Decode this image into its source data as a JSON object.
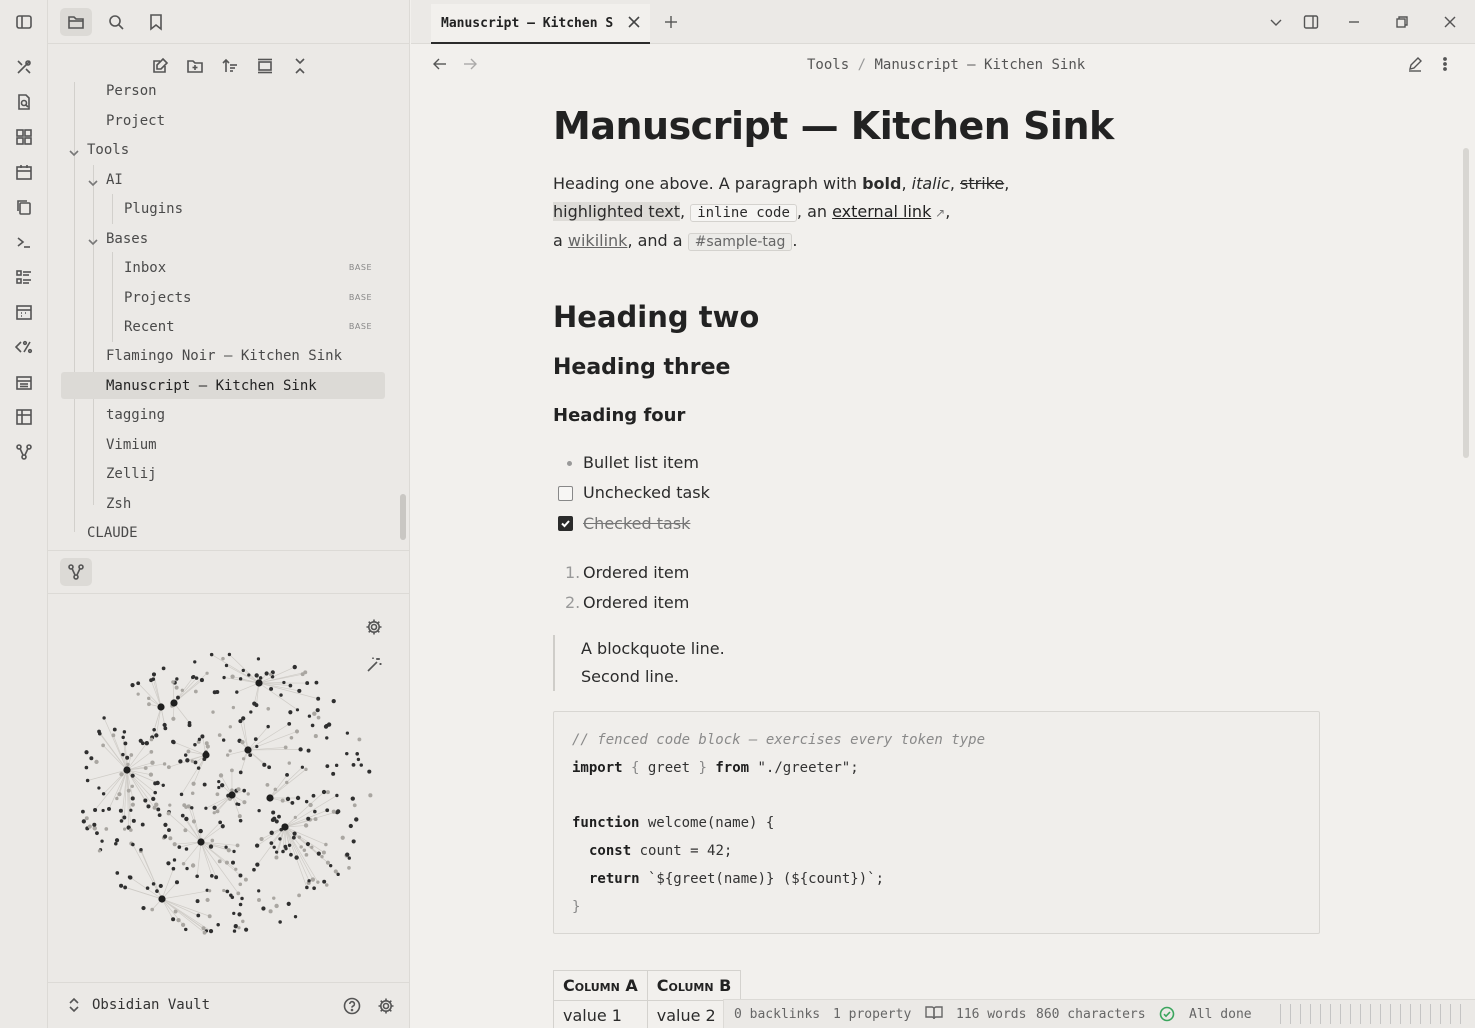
{
  "ribbon": {
    "icons": [
      "tools-icon",
      "search-doc-icon",
      "grid-icon",
      "calendar-icon",
      "copy-icon",
      "terminal-icon",
      "list-icon",
      "calendar-grid-icon",
      "regex-icon",
      "calendar-alt-icon",
      "table-icon",
      "graph-icon"
    ]
  },
  "nav": {
    "tree": [
      {
        "label": "Person",
        "badge": ""
      },
      {
        "label": "Project",
        "badge": ""
      },
      {
        "label": "Tools",
        "badge": ""
      },
      {
        "label": "AI",
        "badge": ""
      },
      {
        "label": "Plugins",
        "badge": ""
      },
      {
        "label": "Bases",
        "badge": ""
      },
      {
        "label": "Inbox",
        "badge": "BASE"
      },
      {
        "label": "Projects",
        "badge": "BASE"
      },
      {
        "label": "Recent",
        "badge": "BASE"
      },
      {
        "label": "Flamingo Noir — Kitchen Sink",
        "badge": ""
      },
      {
        "label": "Manuscript — Kitchen Sink",
        "badge": ""
      },
      {
        "label": "tagging",
        "badge": ""
      },
      {
        "label": "Vimium",
        "badge": ""
      },
      {
        "label": "Zellij",
        "badge": ""
      },
      {
        "label": "Zsh",
        "badge": ""
      },
      {
        "label": "CLAUDE",
        "badge": ""
      }
    ]
  },
  "vault": {
    "name": "Obsidian Vault"
  },
  "tab": {
    "title": "Manuscript — Kitchen Sink"
  },
  "breadcrumb": {
    "folder": "Tools",
    "sep": "/",
    "file": "Manuscript — Kitchen Sink"
  },
  "doc": {
    "title": "Manuscript — Kitchen Sink",
    "p1_a": "Heading one above. A paragraph with ",
    "p1_bold": "bold",
    "p1_comma1": ", ",
    "p1_italic": "italic",
    "p1_comma2": ", ",
    "p1_strike": "strike",
    "p1_comma3": ",",
    "p2_highlight": "highlighted text",
    "p2_comma": ", ",
    "p2_code": "inline code",
    "p2_an": ", an ",
    "p2_link": "external link",
    "p2_end": ",",
    "p3_a": "a ",
    "p3_wikilink": "wikilink",
    "p3_and": ", and a ",
    "p3_tag": "#sample-tag",
    "p3_end": ".",
    "h2": "Heading two",
    "h3": "Heading three",
    "h4": "Heading four",
    "bullet": "Bullet list item",
    "task_unchecked": "Unchecked task",
    "task_checked": "Checked task",
    "ordered": [
      {
        "num": "1.",
        "text": "Ordered item"
      },
      {
        "num": "2.",
        "text": "Ordered item"
      }
    ],
    "quote1": "A blockquote line.",
    "quote2": "Second line.",
    "code": {
      "comment": "// fenced code block — exercises every token type",
      "import_kw": "import",
      "import_rest": " greet ",
      "from_kw": "from",
      "import_path": "\"./greeter\";",
      "function_kw": "function",
      "function_rest": " welcome(name) {",
      "const_kw": "const",
      "const_rest": " count = 42;",
      "return_kw": "return",
      "return_rest": " `${greet(name)} (${count})`;",
      "close": "}"
    },
    "table": {
      "headers": [
        "Column A",
        "Column B"
      ],
      "rows": [
        [
          "value 1",
          "value 2"
        ]
      ]
    }
  },
  "status": {
    "backlinks": "0 backlinks",
    "property": "1 property",
    "words": "116 words",
    "characters": "860 characters",
    "sync": "All done"
  }
}
